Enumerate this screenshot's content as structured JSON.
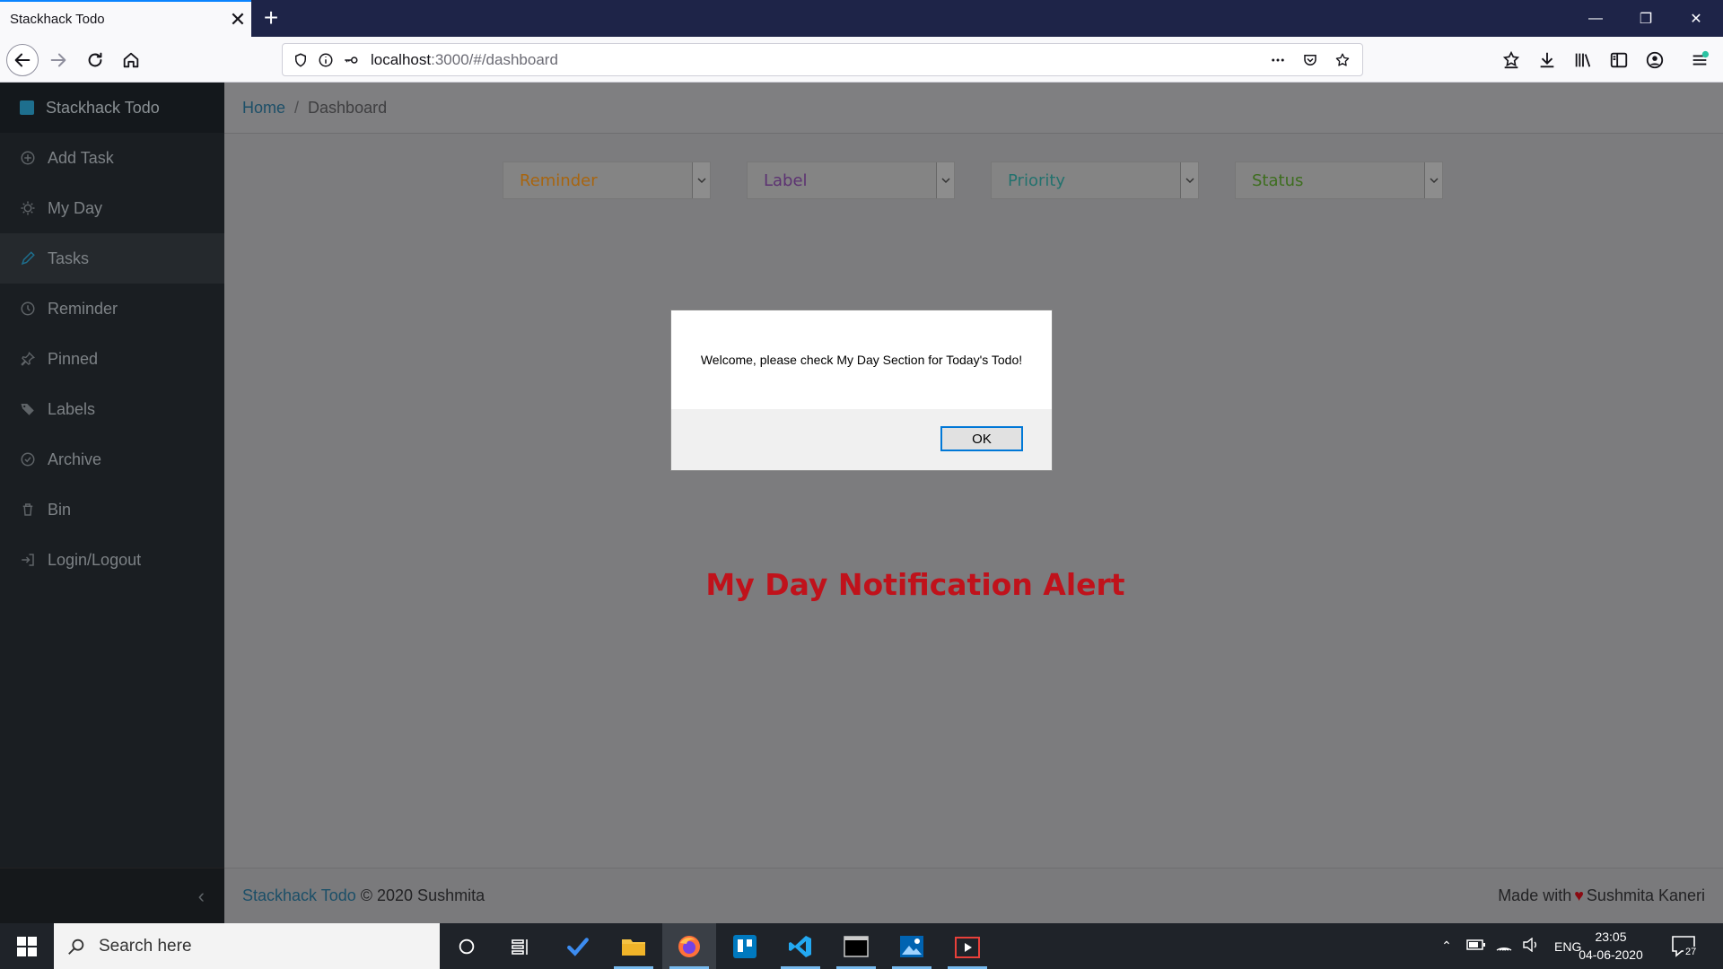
{
  "browser": {
    "tab_title": "Stackhack Todo",
    "tab_close": "✕",
    "new_tab": "+",
    "url_host": "localhost",
    "url_path": ":3000/#/dashboard",
    "window_controls": {
      "minimize": "—",
      "restore": "❐",
      "close": "✕"
    }
  },
  "sidebar": {
    "brand": "Stackhack Todo",
    "items": [
      {
        "label": "Add Task",
        "icon": "plus-circle-icon"
      },
      {
        "label": "My Day",
        "icon": "sun-icon"
      },
      {
        "label": "Tasks",
        "icon": "pencil-icon",
        "active": true
      },
      {
        "label": "Reminder",
        "icon": "clock-icon"
      },
      {
        "label": "Pinned",
        "icon": "pin-icon"
      },
      {
        "label": "Labels",
        "icon": "tags-icon"
      },
      {
        "label": "Archive",
        "icon": "check-circle-icon"
      },
      {
        "label": "Bin",
        "icon": "trash-icon"
      },
      {
        "label": "Login/Logout",
        "icon": "login-icon"
      }
    ],
    "collapse": "‹"
  },
  "breadcrumb": {
    "home": "Home",
    "separator": "/",
    "current": "Dashboard"
  },
  "filters": [
    {
      "label": "Reminder",
      "color": "#a8650f"
    },
    {
      "label": "Label",
      "color": "#5c3272"
    },
    {
      "label": "Priority",
      "color": "#23726e"
    },
    {
      "label": "Status",
      "color": "#3d6e1e"
    }
  ],
  "notification_text": "My Day Notification Alert",
  "dialog": {
    "message": "Welcome, please check My Day Section for Today's Todo!",
    "ok_label": "OK"
  },
  "footer": {
    "brand_link": "Stackhack Todo",
    "copyright": "© 2020 Sushmita",
    "made_with": "Made with",
    "heart": "♥",
    "author": "Sushmita Kaneri"
  },
  "taskbar": {
    "search_placeholder": "Search here",
    "language": "ENG",
    "time": "23:05",
    "date": "04-06-2020",
    "notification_count": "27"
  },
  "colors": {
    "accent": "#0a84ff",
    "alert_red": "#c0121b",
    "sidebar_bg": "#1a1e22"
  }
}
